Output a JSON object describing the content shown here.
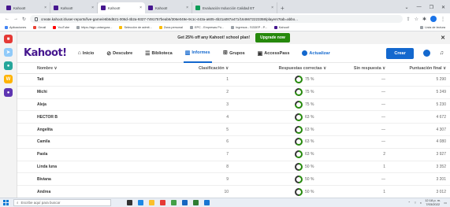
{
  "browser": {
    "tabs": [
      {
        "label": "Kahoot!"
      },
      {
        "label": "Kahoot!"
      },
      {
        "label": "Kahoot!",
        "active": true
      },
      {
        "label": "Kahoot!"
      },
      {
        "label": "Evaluación Inducción Calidad ET"
      }
    ],
    "new_tab": "+",
    "url": "create.kahoot.it/user-reports/live-game/e6b6d621-006d-4b2a-9327-7491757beab6/306e049e-9c1c-443a-a605-4b21a087a471/1646672223358/players?tab=abbo..."
  },
  "bookmarks": [
    {
      "label": "Aplicaciones",
      "icon": "apps-icon"
    },
    {
      "label": "Gmail",
      "icon": "gmail-icon"
    },
    {
      "label": "YouTube",
      "icon": "youtube-icon"
    },
    {
      "label": "https://sign.unisegura...",
      "icon": "link-icon"
    },
    {
      "label": "Selección de admit...",
      "icon": "link-icon"
    },
    {
      "label": "Zona personal",
      "icon": "link-icon"
    },
    {
      "label": "EPC - Empresas Pú...",
      "icon": "link-icon"
    },
    {
      "label": "Ingresos - SGDEP - P...",
      "icon": "link-icon"
    },
    {
      "label": "Kahoot!",
      "icon": "kahoot-icon"
    }
  ],
  "bookmarks_right": "Lista de lectura",
  "promo": {
    "text": "Get 25% off any Kahoot! school plan!",
    "button": "Upgrade now"
  },
  "header": {
    "logo": "Kahoot!",
    "nav": [
      {
        "label": "Inicio",
        "icon": "home-icon"
      },
      {
        "label": "Descubre",
        "icon": "compass-icon"
      },
      {
        "label": "Biblioteca",
        "icon": "list-icon"
      },
      {
        "label": "Informes",
        "icon": "chart-icon",
        "active": true
      },
      {
        "label": "Grupos",
        "icon": "group-icon"
      },
      {
        "label": "AccessPass",
        "icon": "pass-icon"
      }
    ],
    "upgrade": "Actualizar",
    "create": "Crear"
  },
  "table": {
    "columns": {
      "name": "Nombre ∨",
      "rank": "Clasificación ∨",
      "correct": "Respuestas correctas ∨",
      "no_answer": "Sin respuesta ∨",
      "score": "Puntuación final ∨"
    },
    "rows": [
      {
        "name": "Tati",
        "rank": "1",
        "correct": "75 %",
        "correct_fraction": 0.75,
        "no_answer": "—",
        "score": "5 290"
      },
      {
        "name": "Michi",
        "rank": "2",
        "correct": "75 %",
        "correct_fraction": 0.75,
        "no_answer": "—",
        "score": "5 249"
      },
      {
        "name": "Aleja",
        "rank": "3",
        "correct": "75 %",
        "correct_fraction": 0.75,
        "no_answer": "—",
        "score": "5 230"
      },
      {
        "name": "HECTOR B",
        "rank": "4",
        "correct": "63 %",
        "correct_fraction": 0.63,
        "no_answer": "—",
        "score": "4 672"
      },
      {
        "name": "Angelita",
        "rank": "5",
        "correct": "63 %",
        "correct_fraction": 0.63,
        "no_answer": "—",
        "score": "4 307"
      },
      {
        "name": "Camila",
        "rank": "6",
        "correct": "63 %",
        "correct_fraction": 0.63,
        "no_answer": "—",
        "score": "4 080"
      },
      {
        "name": "Paola",
        "rank": "7",
        "correct": "63 %",
        "correct_fraction": 0.63,
        "no_answer": "2",
        "score": "3 927"
      },
      {
        "name": "Linda luna",
        "rank": "8",
        "correct": "50 %",
        "correct_fraction": 0.5,
        "no_answer": "1",
        "score": "3 352"
      },
      {
        "name": "Biviana",
        "rank": "9",
        "correct": "50 %",
        "correct_fraction": 0.5,
        "no_answer": "—",
        "score": "3 201"
      },
      {
        "name": "Andrea",
        "rank": "10",
        "correct": "50 %",
        "correct_fraction": 0.5,
        "no_answer": "1",
        "score": "3 012"
      }
    ]
  },
  "taskbar": {
    "search_placeholder": "Escribe aquí para buscar",
    "time": "12:18 p. m.",
    "date": "7/03/2022"
  },
  "colors": {
    "kahoot_purple": "#46178f",
    "accent_blue": "#1368ce",
    "promo_green": "#26890c"
  }
}
